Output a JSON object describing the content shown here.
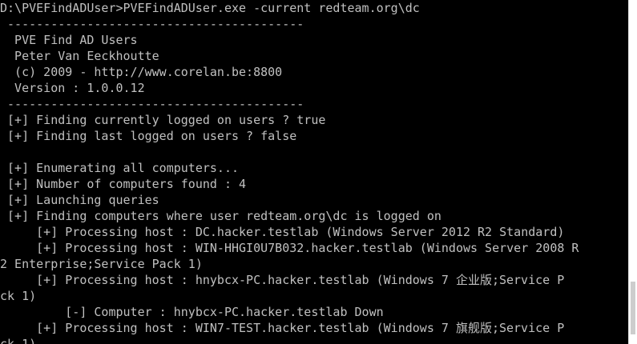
{
  "colors": {
    "background": "#000000",
    "text": "#c0c0c0",
    "scrollbar": "#ffffff"
  },
  "console": {
    "lines": [
      "D:\\PVEFindADUser>PVEFindADUser.exe -current redteam.org\\dc",
      " -----------------------------------------",
      "  PVE Find AD Users",
      "  Peter Van Eeckhoutte",
      "  (c) 2009 - http://www.corelan.be:8800",
      "  Version : 1.0.0.12",
      " -----------------------------------------",
      " [+] Finding currently logged on users ? true",
      " [+] Finding last logged on users ? false",
      "",
      " [+] Enumerating all computers...",
      " [+] Number of computers found : 4",
      " [+] Launching queries",
      " [+] Finding computers where user redteam.org\\dc is logged on",
      "     [+] Processing host : DC.hacker.testlab (Windows Server 2012 R2 Standard)",
      "     [+] Processing host : WIN-HHGI0U7B032.hacker.testlab (Windows Server 2008 R",
      "2 Enterprise;Service Pack 1)",
      "     [+] Processing host : hnybcx-PC.hacker.testlab (Windows 7 企业版;Service P",
      "ck 1)",
      "         [-] Computer : hnybcx-PC.hacker.testlab Down",
      "     [+] Processing host : WIN7-TEST.hacker.testlab (Windows 7 旗舰版;Service P",
      "ck 1)"
    ]
  }
}
